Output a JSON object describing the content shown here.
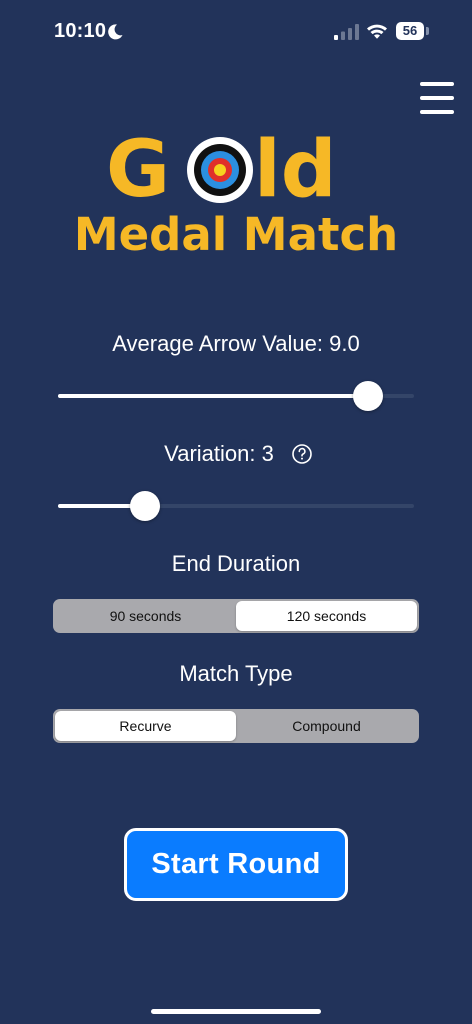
{
  "status_bar": {
    "time": "10:10",
    "battery": "56",
    "icons": [
      "moon-icon",
      "cellular-signal-icon",
      "wifi-icon",
      "battery-icon"
    ]
  },
  "header": {
    "menu_icon": "hamburger-menu-icon"
  },
  "logo": {
    "line1": "GOLD",
    "line2": "Medal Match",
    "color": "#f6b826",
    "icon": "archery-target-icon"
  },
  "average_arrow": {
    "label": "Average Arrow Value: 9.0",
    "value": 9.0,
    "fraction": 0.87
  },
  "variation": {
    "label": "Variation: 3",
    "value": 3,
    "fraction": 0.245,
    "help_icon": "question-circle-icon"
  },
  "end_duration": {
    "label": "End Duration",
    "options": [
      "90 seconds",
      "120 seconds"
    ],
    "selected": "120 seconds"
  },
  "match_type": {
    "label": "Match Type",
    "options": [
      "Recurve",
      "Compound"
    ],
    "selected": "Recurve"
  },
  "start_button": {
    "label": "Start Round"
  },
  "colors": {
    "background": "#22335a",
    "accent": "#0a7cff",
    "gold": "#f6b826"
  }
}
